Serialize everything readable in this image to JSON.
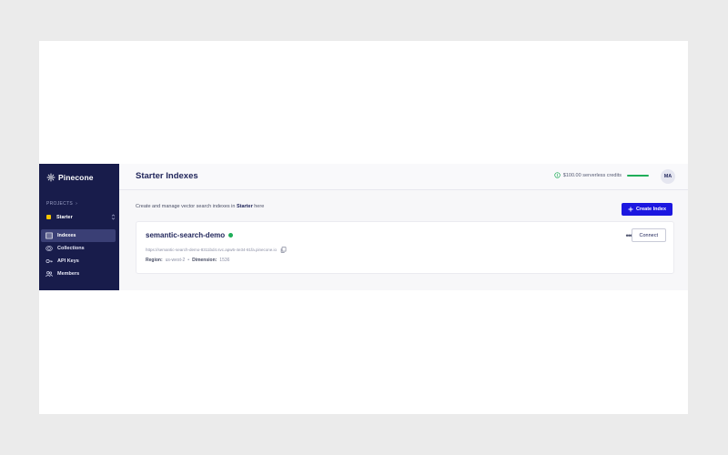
{
  "brand": {
    "name": "Pinecone"
  },
  "sidebar": {
    "projects_label": "PROJECTS",
    "projects_chevron": "›",
    "project_name": "Starter",
    "items": [
      {
        "label": "Indexes",
        "icon": "table-icon",
        "active": true
      },
      {
        "label": "Collections",
        "icon": "collections-icon",
        "active": false
      },
      {
        "label": "API Keys",
        "icon": "key-icon",
        "active": false
      },
      {
        "label": "Members",
        "icon": "members-icon",
        "active": false
      }
    ]
  },
  "header": {
    "title": "Starter Indexes",
    "credits_text": "$100.00 serverless credits",
    "credits_remaining_fraction": 1.0,
    "avatar_initials": "MA"
  },
  "main": {
    "subtitle_pre": "Create and manage vector search indexes in ",
    "subtitle_project": "Starter",
    "subtitle_post": " here",
    "create_button": "Create Index"
  },
  "index_card": {
    "name": "semantic-search-demo",
    "status_color": "#1fae59",
    "host": "https://semantic-search-demo-8311bd4.svc.apw5-4e34-81fa.pinecone.io",
    "region_label": "Region:",
    "region_value": "us-west-2",
    "separator": "•",
    "dimension_label": "Dimension:",
    "dimension_value": "1536",
    "more_label": "•••",
    "connect_button": "Connect"
  },
  "colors": {
    "sidebar_bg": "#181c4b",
    "accent": "#1c17e0",
    "project_square": "#f5c400",
    "status_green": "#1fae59"
  }
}
